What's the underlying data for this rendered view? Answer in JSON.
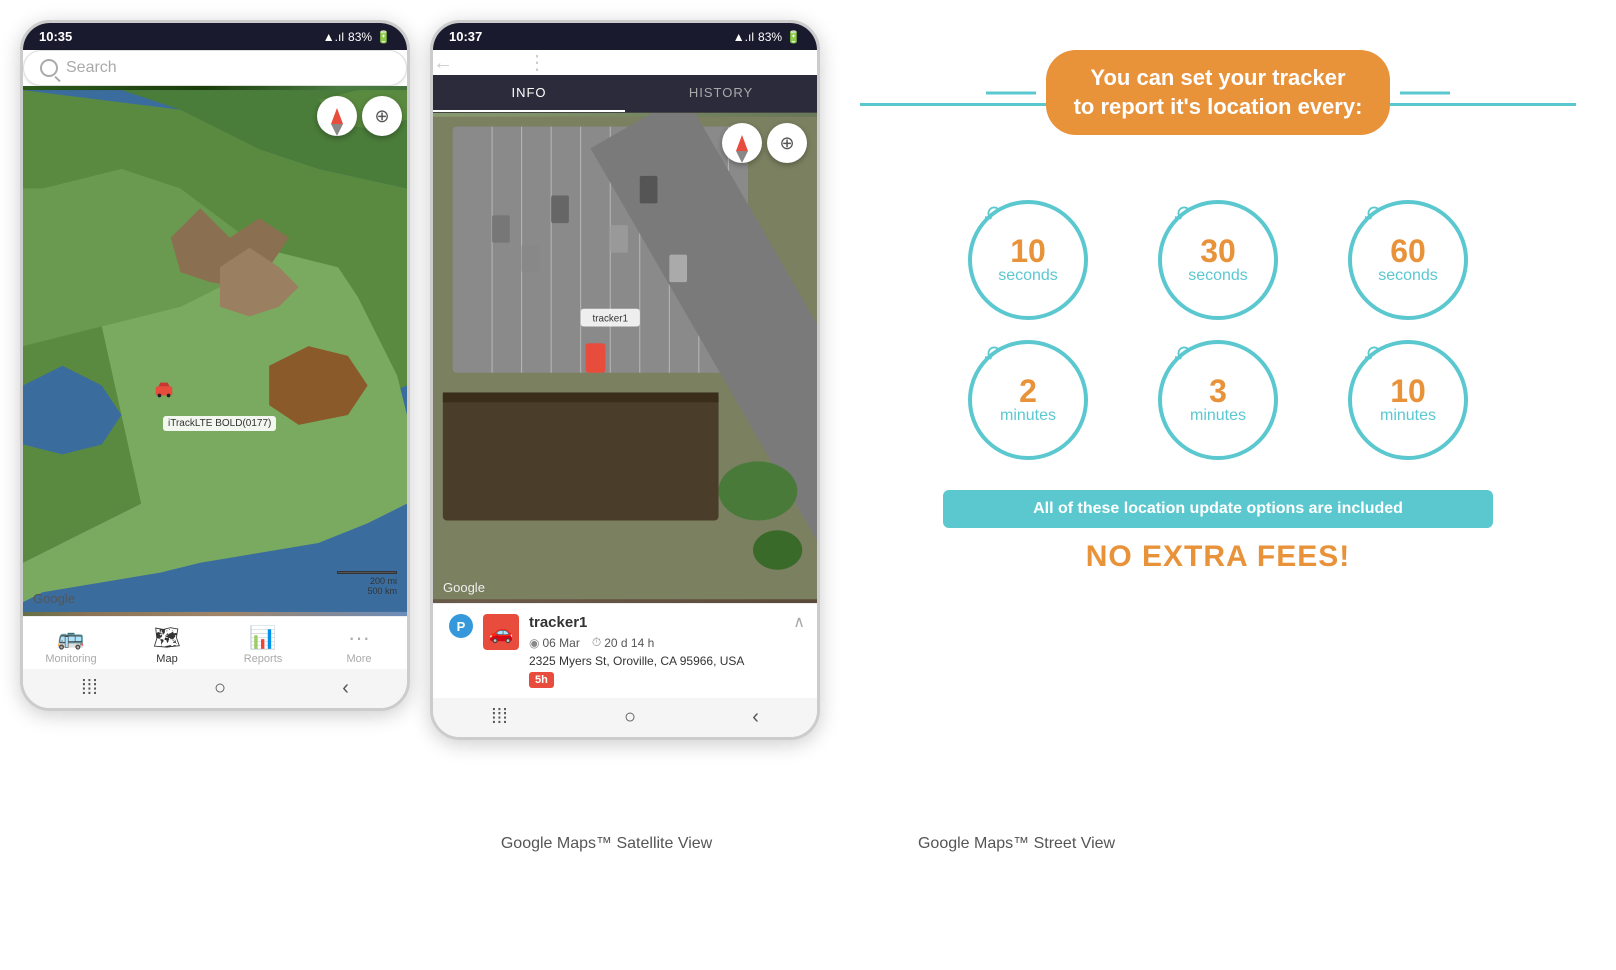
{
  "phone1": {
    "status_time": "10:35",
    "status_signal": "▲.ıl",
    "status_battery": "83%",
    "search_placeholder": "Search",
    "google_watermark": "Google",
    "scale_200mi": "200 mi",
    "scale_500km": "500 km",
    "tracker_label": "iTrackLTE BOLD(0177)",
    "nav_items": [
      {
        "icon": "🚌",
        "label": "Monitoring",
        "active": false
      },
      {
        "icon": "🗺",
        "label": "Map",
        "active": true
      },
      {
        "icon": "📊",
        "label": "Reports",
        "active": false
      },
      {
        "icon": "···",
        "label": "More",
        "active": false
      }
    ],
    "caption": "Google Maps™ Satellite View"
  },
  "phone2": {
    "status_time": "10:37",
    "status_signal": "▲.ıl",
    "status_battery": "83%",
    "tracker_name": "tracker1",
    "tabs": [
      {
        "label": "INFO",
        "active": true
      },
      {
        "label": "HISTORY",
        "active": false
      }
    ],
    "google_watermark": "Google",
    "info_panel": {
      "name": "tracker1",
      "date": "06 Mar",
      "duration": "20 d 14 h",
      "address": "2325 Myers St, Oroville, CA 95966, USA",
      "badge": "5h"
    },
    "caption": "Google Maps™ Street View"
  },
  "info_graphic": {
    "title_line1": "You can set your tracker",
    "title_line2": "to report it's location every:",
    "circles": [
      {
        "number": "10",
        "unit": "seconds"
      },
      {
        "number": "30",
        "unit": "seconds"
      },
      {
        "number": "60",
        "unit": "seconds"
      },
      {
        "number": "2",
        "unit": "minutes"
      },
      {
        "number": "3",
        "unit": "minutes"
      },
      {
        "number": "10",
        "unit": "minutes"
      }
    ],
    "fee_text": "All of these location update options are included",
    "no_fees_text": "NO EXTRA FEES!"
  }
}
